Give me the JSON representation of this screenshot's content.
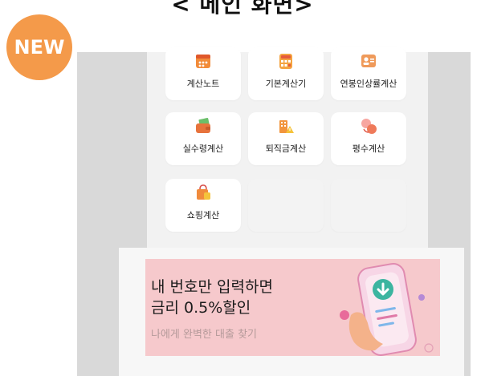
{
  "header": {
    "title": "< 메인 화면>"
  },
  "badge": {
    "label": "NEW",
    "color": "#f49a4a"
  },
  "menu": {
    "items": [
      {
        "label": "계산노트",
        "icon": "calendar-icon"
      },
      {
        "label": "기본계산기",
        "icon": "calculator-icon"
      },
      {
        "label": "연봉인상률계산",
        "icon": "id-card-icon"
      },
      {
        "label": "실수령계산",
        "icon": "wallet-money-icon"
      },
      {
        "label": "퇴직금계산",
        "icon": "building-warning-icon"
      },
      {
        "label": "평수계산",
        "icon": "area-convert-icon"
      },
      {
        "label": "쇼핑계산",
        "icon": "shopping-bag-icon"
      }
    ]
  },
  "banner": {
    "line1": "내 번호만 입력하면",
    "line2": "금리 0.5%할인",
    "subtitle": "나에게 완벽한 대출 찾기",
    "illustration": "phone-download-icon",
    "background": "#f6c9cc"
  }
}
